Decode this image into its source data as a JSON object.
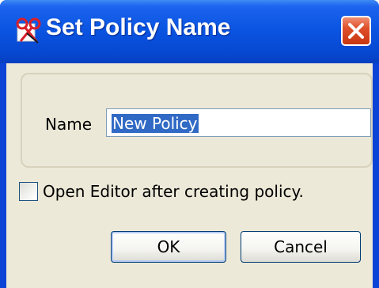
{
  "window": {
    "title": "Set Policy Name",
    "app_icon": "policy-scissors-icon",
    "close_icon": "close-x-icon"
  },
  "form": {
    "name_label": "Name",
    "name_value": "New Policy",
    "open_editor_label": "Open Editor after creating policy.",
    "open_editor_checked": false
  },
  "buttons": {
    "ok_label": "OK",
    "cancel_label": "Cancel"
  },
  "colors": {
    "titlebar": "#0a55e2",
    "client": "#ece9d8",
    "selection": "#316ac5",
    "close": "#df4f2a"
  }
}
